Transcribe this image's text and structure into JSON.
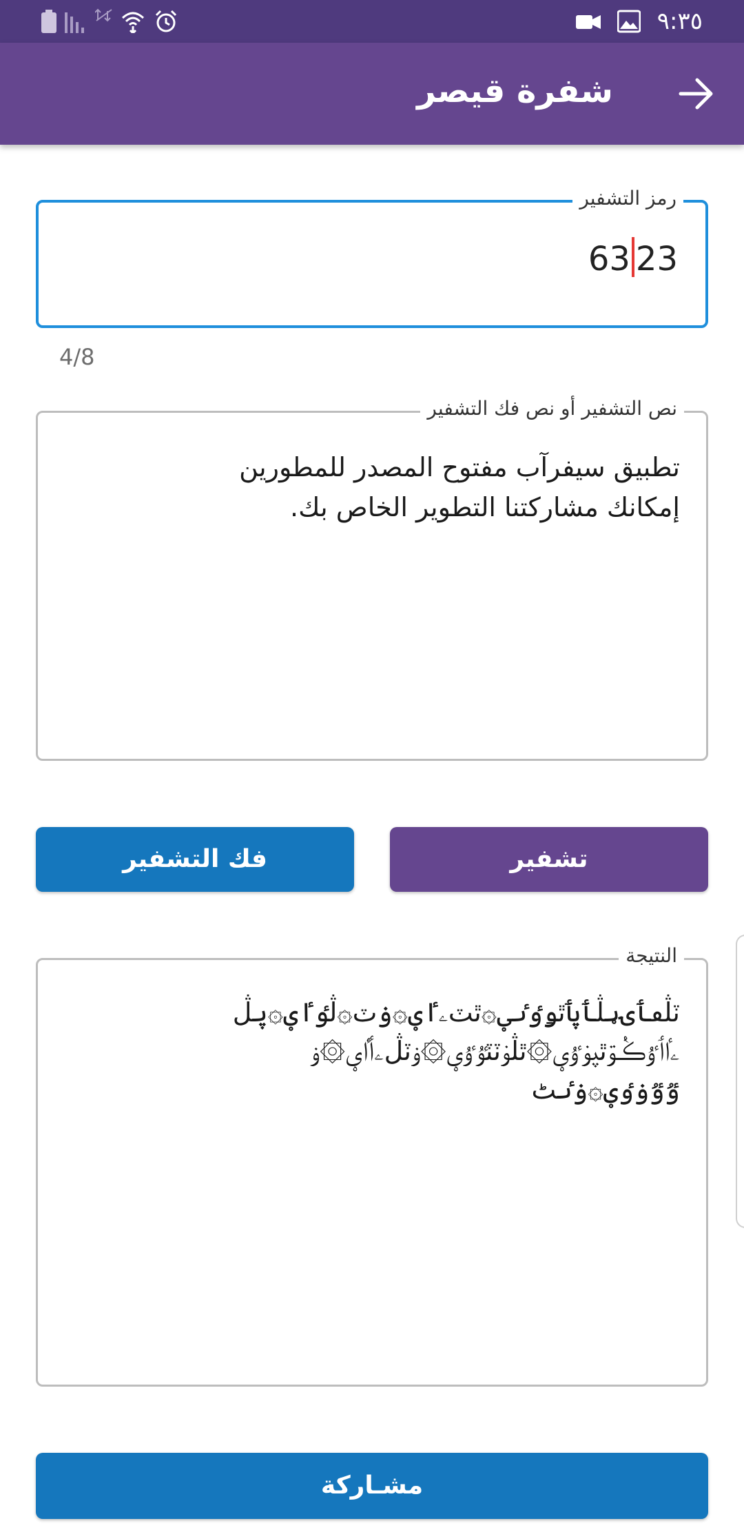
{
  "status_bar": {
    "time": "٩:٣٥",
    "icons": [
      "video-icon",
      "image-icon",
      "alarm-icon",
      "wifi-icon",
      "data-off-icon",
      "signal-icon",
      "battery-icon"
    ]
  },
  "app_bar": {
    "title": "شفرة قيصر",
    "back_icon": "arrow-icon"
  },
  "key_field": {
    "label": "رمز التشفير",
    "value_before_cursor": "63",
    "value_after_cursor": "23",
    "counter": "4/8"
  },
  "text_field": {
    "label": "نص التشفير أو نص فك التشفير",
    "value": "تطبيق سيفرآب مفتوح المصدر للمطورين\nإمكانك مشاركتنا التطوير الخاص بك."
  },
  "buttons": {
    "encrypt": "تشفير",
    "decrypt": "فك التشفير",
    "share": "مشـاركة"
  },
  "result_field": {
    "label": "النتيجة",
    "value": "ٽڷٯٲۍؠڷٲۑٲٿۅٶٸؠ۞ٿٽۦٵؠ۞ۏٽ۞ڷٶٵؠ۞ۑڷ\nۦٵٲٷڪٝۊٿۑۏٷؠ۞ٿڷۏٽٽٷٷؠ۞ۏٽڷۦٲٵؠ۞ۏ\nٷٷۏٶؠ۞ۏٸٹ"
  },
  "colors": {
    "status_bar": "#4f3a7e",
    "app_bar": "#65468f",
    "encrypt_button": "#65468f",
    "decrypt_button": "#1577bd",
    "share_button": "#1577bd",
    "focused_outline": "#1f8fdc",
    "cursor": "#e53935"
  }
}
